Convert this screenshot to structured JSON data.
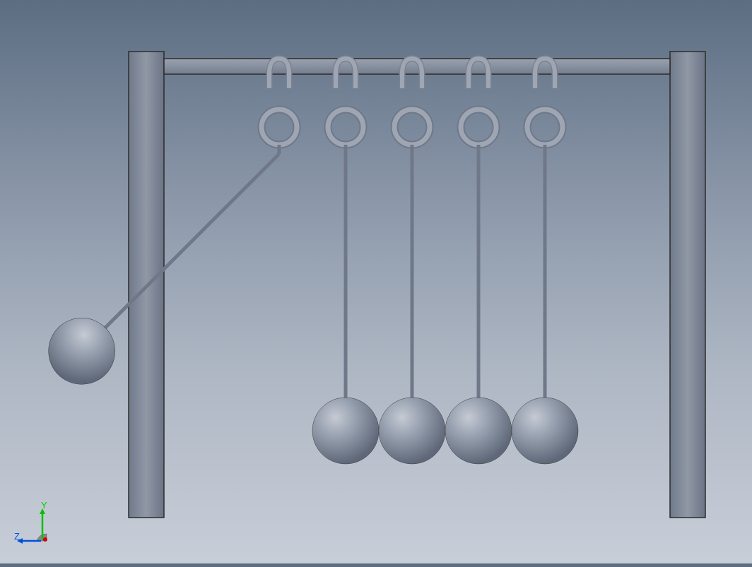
{
  "axes": {
    "y_label": "Y",
    "z_label": "Z",
    "y_color": "#00d000",
    "z_color": "#0050e0",
    "x_color": "#d00000"
  },
  "model": {
    "frame_color_light": "#a0a8b5",
    "frame_color_dark": "#6b7485",
    "ball_color_light": "#b8bfc9",
    "ball_color_dark": "#5f6878",
    "swing_angle_deg": 45
  }
}
